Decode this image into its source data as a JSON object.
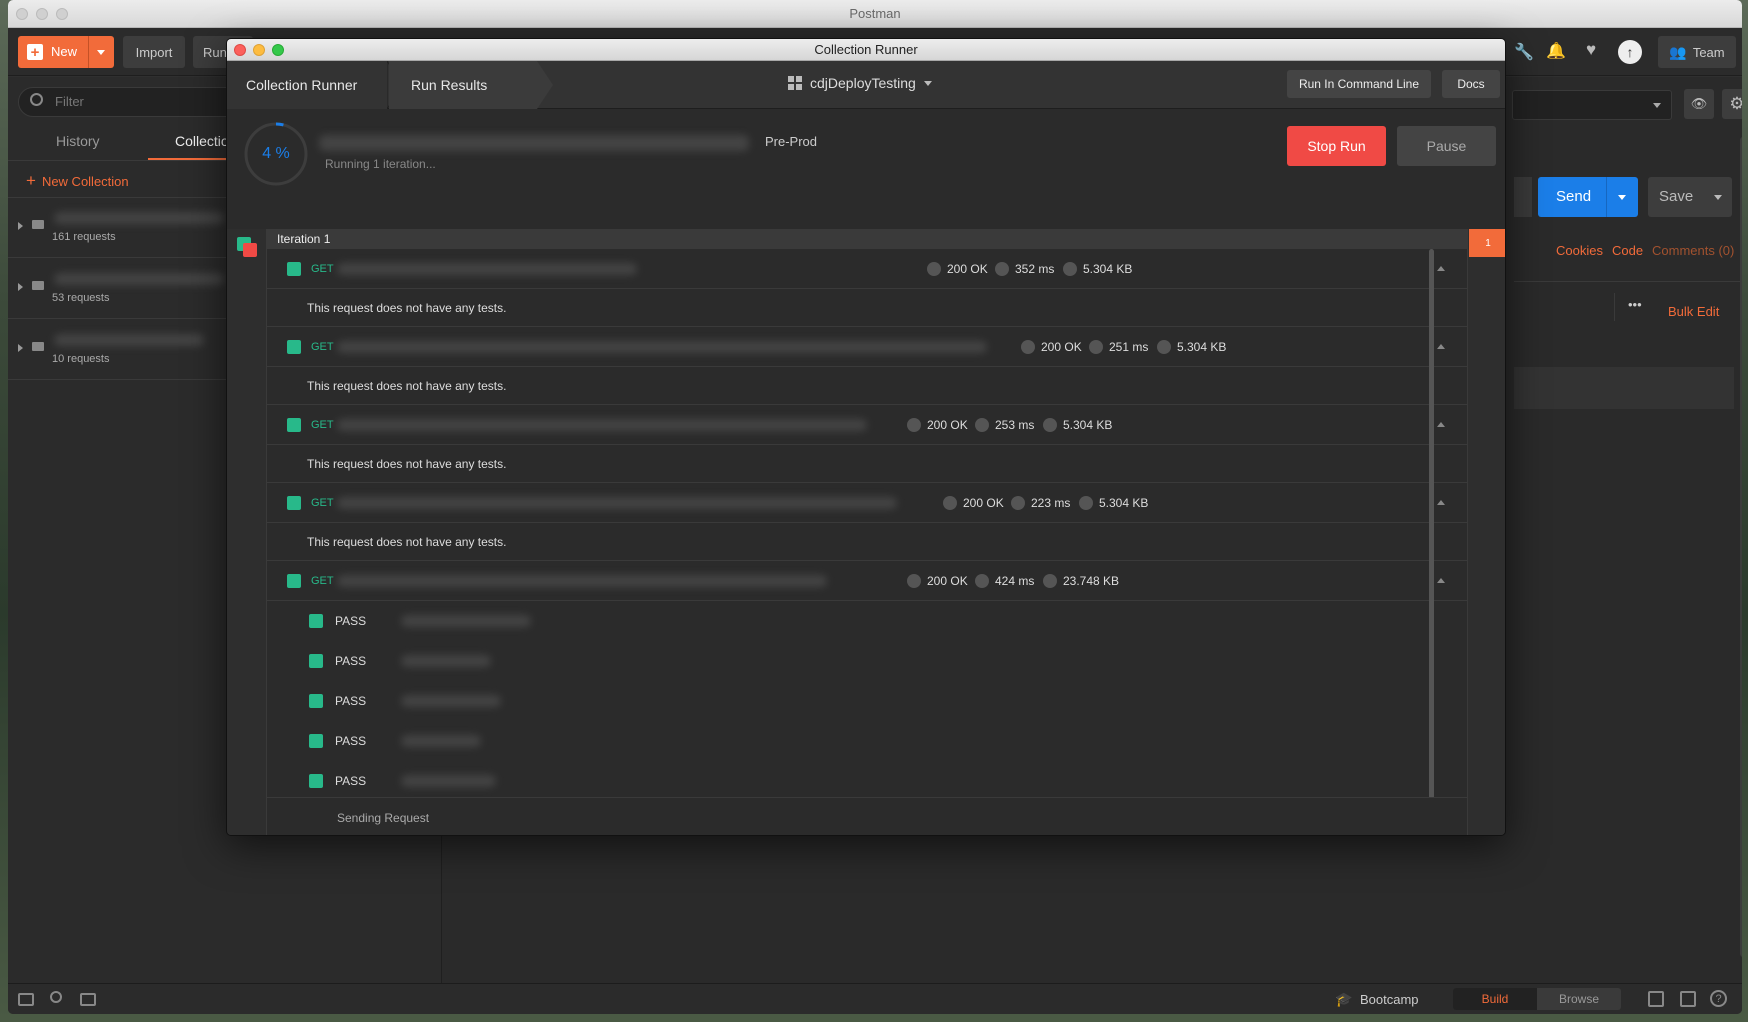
{
  "postman": {
    "window_title": "Postman",
    "toolbar": {
      "new_label": "New",
      "import_label": "Import",
      "runner_label": "Runner",
      "team_label": "Team"
    },
    "sidebar": {
      "filter_placeholder": "Filter",
      "tabs": [
        {
          "label": "History"
        },
        {
          "label": "Collections"
        }
      ],
      "new_collection_label": "New Collection",
      "collections": [
        {
          "count": "161 requests"
        },
        {
          "count": "53 requests"
        },
        {
          "count": "10 requests"
        }
      ]
    },
    "request_panel": {
      "send_label": "Send",
      "save_label": "Save",
      "cookies_label": "Cookies",
      "code_label": "Code",
      "comments_label": "Comments (0)",
      "bulk_edit_label": "Bulk Edit",
      "more_label": "•••"
    },
    "statusbar": {
      "bootcamp_label": "Bootcamp",
      "build_label": "Build",
      "browse_label": "Browse"
    }
  },
  "runner": {
    "window_title": "Collection Runner",
    "breadcrumb": [
      "Collection Runner",
      "Run Results"
    ],
    "collection_name": "cdjDeployTesting",
    "command_line_label": "Run In Command Line",
    "docs_label": "Docs",
    "progress": {
      "percent": 4,
      "percent_label": "4 %"
    },
    "environment": "Pre-Prod",
    "running_text": "Running 1 iteration...",
    "stop_label": "Stop Run",
    "pause_label": "Pause",
    "iteration_label": "Iteration 1",
    "iteration_marker": "1",
    "requests": [
      {
        "method": "GET",
        "status": "200 OK",
        "time": "352 ms",
        "size": "5.304 KB",
        "message": "This request does not have any tests."
      },
      {
        "method": "GET",
        "status": "200 OK",
        "time": "251 ms",
        "size": "5.304 KB",
        "message": "This request does not have any tests."
      },
      {
        "method": "GET",
        "status": "200 OK",
        "time": "253 ms",
        "size": "5.304 KB",
        "message": "This request does not have any tests."
      },
      {
        "method": "GET",
        "status": "200 OK",
        "time": "223 ms",
        "size": "5.304 KB",
        "message": "This request does not have any tests."
      },
      {
        "method": "GET",
        "status": "200 OK",
        "time": "424 ms",
        "size": "23.748 KB"
      }
    ],
    "test_results": [
      {
        "label": "PASS"
      },
      {
        "label": "PASS"
      },
      {
        "label": "PASS"
      },
      {
        "label": "PASS"
      },
      {
        "label": "PASS"
      }
    ],
    "footer_status": "Sending Request"
  },
  "colors": {
    "accent": "#f26b3a",
    "success": "#28b98a",
    "stop": "#f04a45",
    "send": "#1b7ee8"
  }
}
